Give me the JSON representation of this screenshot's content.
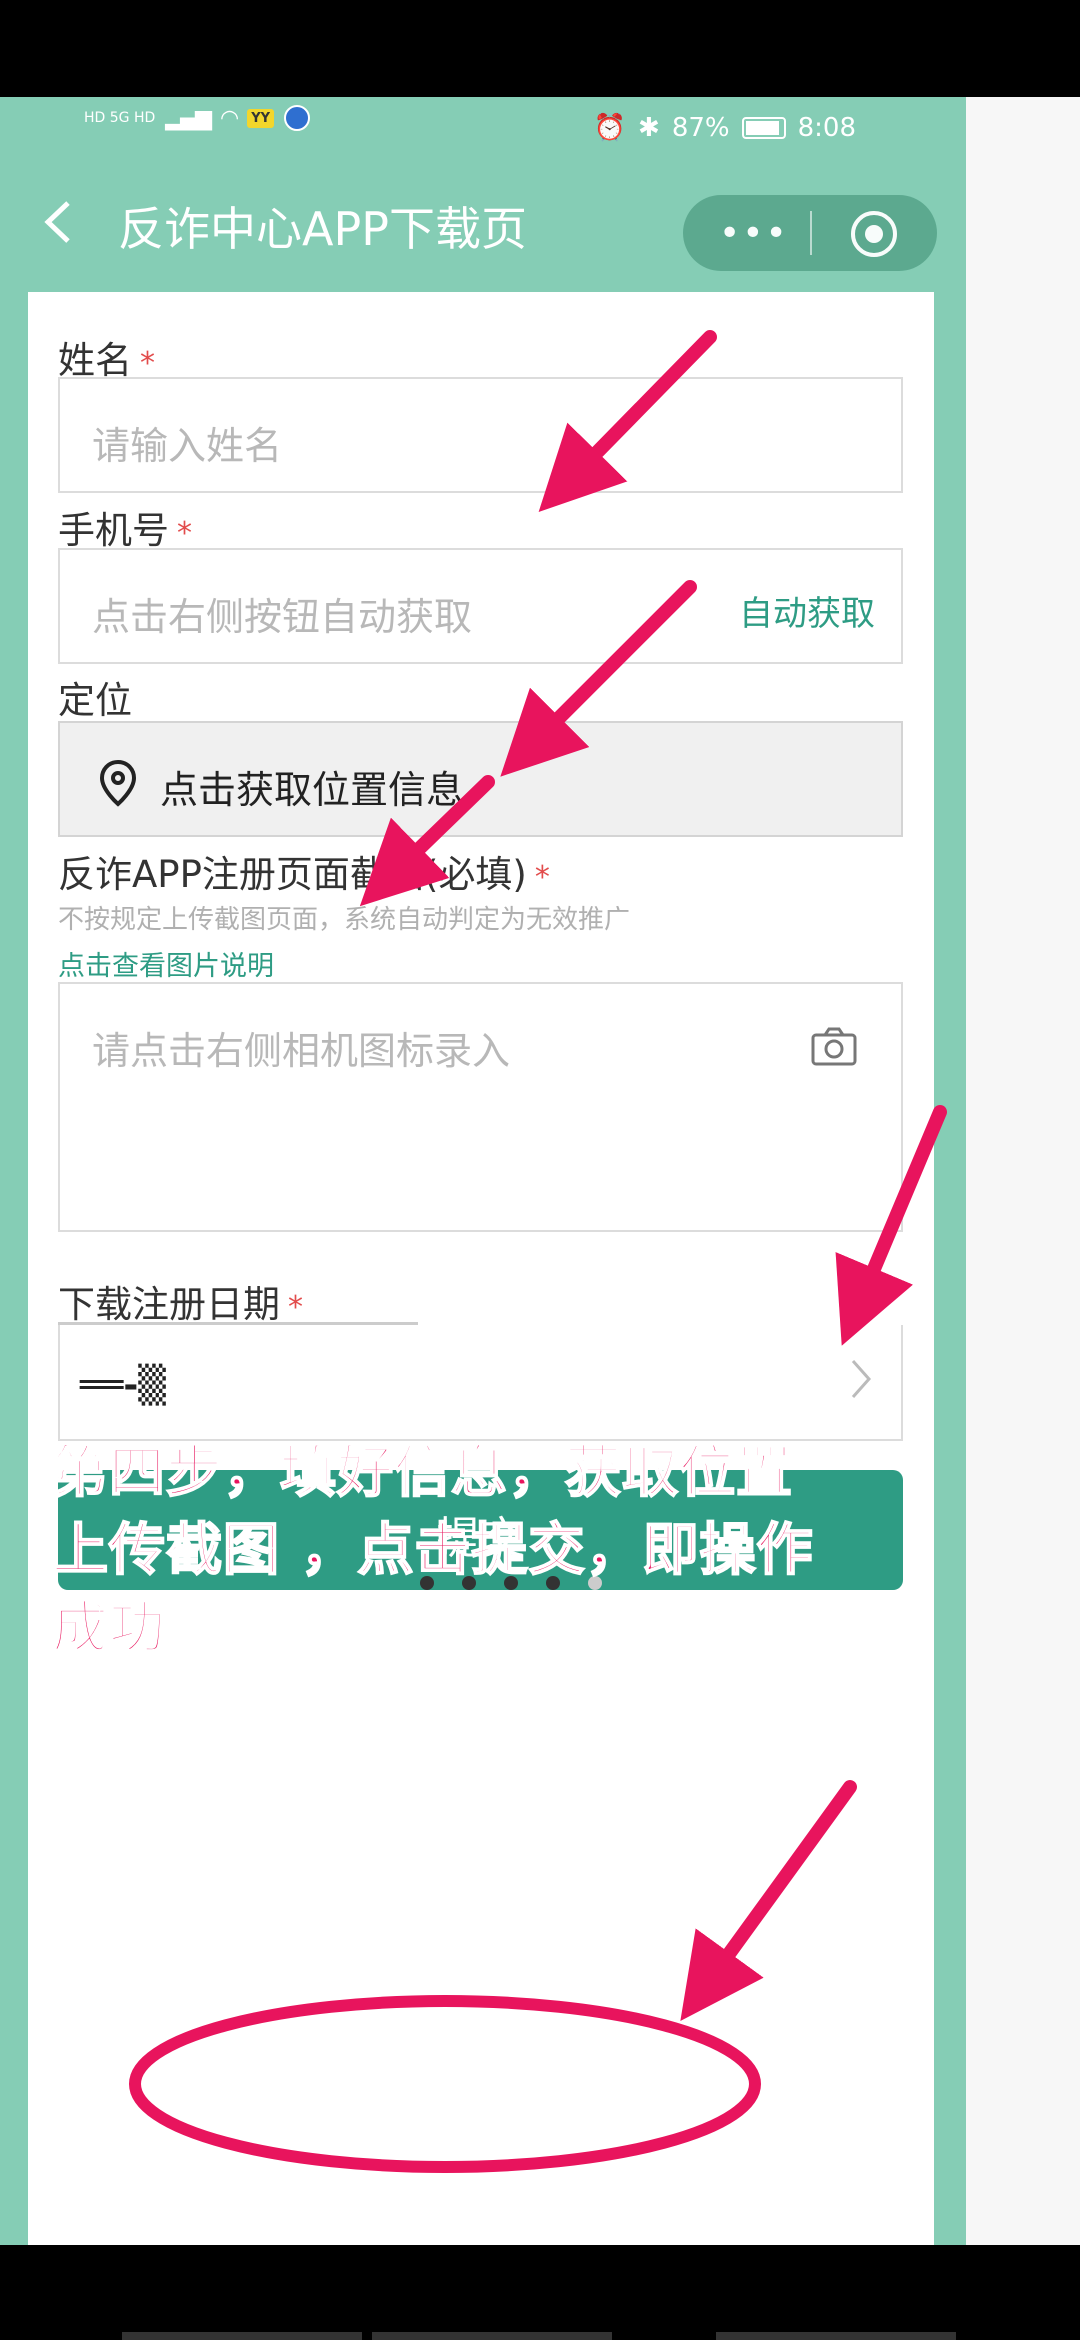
{
  "status_bar": {
    "left_indicators": "HD 5G HD",
    "signal": "ᴵ▐▐▐",
    "app_badge": "YY",
    "battery_text": "87%",
    "time": "8:08"
  },
  "title_bar": {
    "back_symbol": "‹",
    "title": "反诈中心APP下载页",
    "menu_dots": "•••"
  },
  "form": {
    "name_label": "姓名",
    "name_required": "*",
    "name_placeholder": "请输入姓名",
    "phone_label": "手机号",
    "phone_required": "*",
    "phone_placeholder": "点击右侧按钮自动获取",
    "phone_auto_button": "自动获取",
    "location_label": "定位",
    "location_button": "点击获取位置信息",
    "screenshot_label": "反诈APP注册页面截图(必填)",
    "screenshot_required": "*",
    "screenshot_hint": "不按规定上传截图页面，系统自动判定为无效推广",
    "screenshot_link": "点击查看图片说明",
    "screenshot_placeholder": "请点击右侧相机图标录入",
    "date_label": "下载注册日期",
    "date_required": "*",
    "date_value": "══-▒",
    "submit_label": "提交"
  },
  "annotation": {
    "line1": "第四步，填好信息，获取位置",
    "line2": "上传截图 ，点击提交，即操作",
    "line3": "成功"
  },
  "colors": {
    "header_green": "#85cdb5",
    "button_green": "#2e9c84",
    "annotation_pink": "#e8145d"
  },
  "pager": {
    "count": 5,
    "active": 3
  }
}
